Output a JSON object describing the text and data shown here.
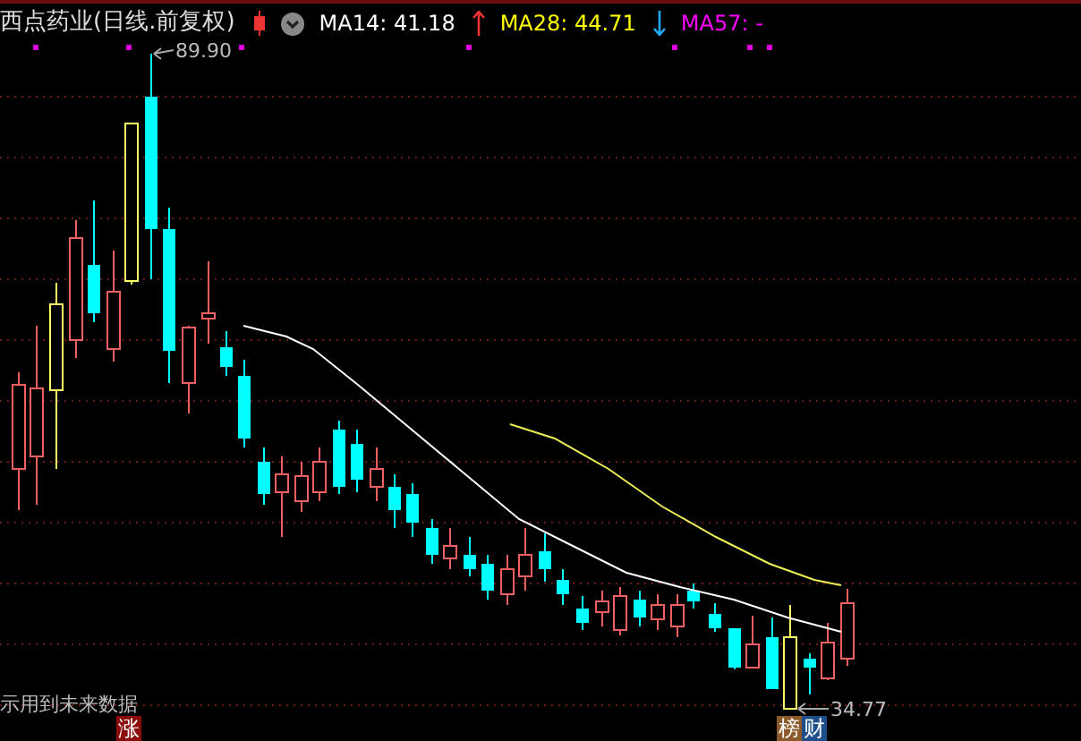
{
  "header": {
    "title": "西点药业(日线.前复权)",
    "indicators": [
      {
        "label": "MA14: 41.18",
        "kind": "up",
        "color": "#ffffff"
      },
      {
        "label": "MA28: 44.71",
        "kind": "down",
        "color": "#ffff00"
      },
      {
        "label": "MA57: -",
        "kind": "plain",
        "color": "#ff00ff"
      }
    ]
  },
  "chart": {
    "high_label": "89.90",
    "low_label": "34.77",
    "notice": "示用到未来数据",
    "left_tags": [
      {
        "text": "涨",
        "color": "#8b0a0a"
      }
    ],
    "right_tags": [
      {
        "text": "榜",
        "color": "#8a5a2a"
      },
      {
        "text": "财",
        "color": "#1f4f8a"
      }
    ]
  }
}
